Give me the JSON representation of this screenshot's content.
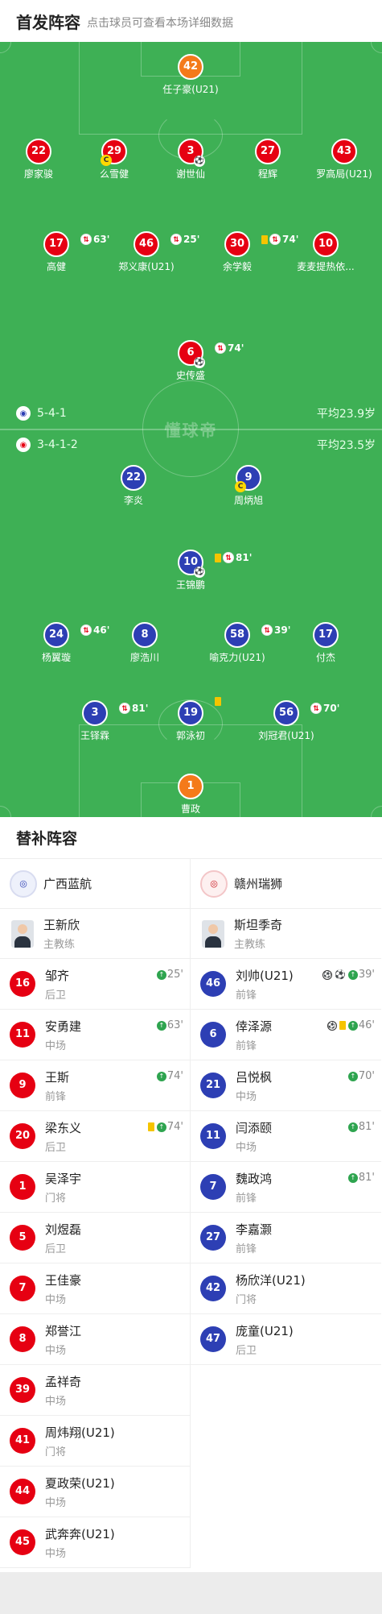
{
  "header": {
    "title": "首发阵容",
    "subtitle": "点击球员可查看本场详细数据"
  },
  "pitch": {
    "watermark": "懂球帝",
    "home_formation": "5-4-1",
    "home_avg_age": "平均23.9岁",
    "away_formation": "3-4-1-2",
    "away_avg_age": "平均23.5岁"
  },
  "home_lineup": [
    {
      "num": "42",
      "name": "任子豪(U21)",
      "gk": true
    },
    {
      "num": "22",
      "name": "廖家骏"
    },
    {
      "num": "29",
      "name": "么雪健",
      "captain": "C"
    },
    {
      "num": "3",
      "name": "谢世仙",
      "goal": true
    },
    {
      "num": "27",
      "name": "程辉"
    },
    {
      "num": "43",
      "name": "罗高局(U21)"
    },
    {
      "num": "17",
      "name": "高健",
      "sub_min": "63'"
    },
    {
      "num": "46",
      "name": "郑义康(U21)",
      "sub_min": "25'"
    },
    {
      "num": "30",
      "name": "余学毅",
      "sub_min": "74'",
      "yellow": true
    },
    {
      "num": "10",
      "name": "麦麦提热依..."
    },
    {
      "num": "6",
      "name": "史传盛",
      "sub_min": "74'",
      "goal": true
    }
  ],
  "away_lineup": [
    {
      "num": "22",
      "name": "李炎"
    },
    {
      "num": "9",
      "name": "周炳旭",
      "captain": "C"
    },
    {
      "num": "10",
      "name": "王锦鹏",
      "sub_min": "81'",
      "yellow": true,
      "assist": true
    },
    {
      "num": "24",
      "name": "杨翼璇",
      "sub_min": "46'"
    },
    {
      "num": "8",
      "name": "廖浩川"
    },
    {
      "num": "58",
      "name": "喻克力(U21)",
      "sub_min": "39'"
    },
    {
      "num": "17",
      "name": "付杰"
    },
    {
      "num": "3",
      "name": "王铎霖",
      "sub_min": "81'"
    },
    {
      "num": "19",
      "name": "郭泳初",
      "yellow": true
    },
    {
      "num": "56",
      "name": "刘冠君(U21)",
      "sub_min": "70'"
    },
    {
      "num": "1",
      "name": "曹政",
      "gk": true
    }
  ],
  "subs": {
    "title": "替补阵容",
    "left": {
      "team": "广西蓝航",
      "coach": {
        "name": "王新欣",
        "role": "主教练"
      },
      "players": [
        {
          "num": "16",
          "name": "邹齐",
          "pos": "后卫",
          "sub_in": "25'"
        },
        {
          "num": "11",
          "name": "安勇建",
          "pos": "中场",
          "sub_in": "63'"
        },
        {
          "num": "9",
          "name": "王斯",
          "pos": "前锋",
          "sub_in": "74'"
        },
        {
          "num": "20",
          "name": "梁东义",
          "pos": "后卫",
          "sub_in": "74'",
          "yellow": true
        },
        {
          "num": "1",
          "name": "吴泽宇",
          "pos": "门将"
        },
        {
          "num": "5",
          "name": "刘煜磊",
          "pos": "后卫"
        },
        {
          "num": "7",
          "name": "王佳豪",
          "pos": "中场"
        },
        {
          "num": "8",
          "name": "郑誉江",
          "pos": "中场"
        },
        {
          "num": "39",
          "name": "孟祥奇",
          "pos": "中场"
        },
        {
          "num": "41",
          "name": "周炜翔(U21)",
          "pos": "门将"
        },
        {
          "num": "44",
          "name": "夏政荣(U21)",
          "pos": "中场"
        },
        {
          "num": "45",
          "name": "武奔奔(U21)",
          "pos": "中场"
        }
      ]
    },
    "right": {
      "team": "赣州瑞狮",
      "coach": {
        "name": "斯坦季奇",
        "role": "主教练"
      },
      "players": [
        {
          "num": "46",
          "name": "刘帅(U21)",
          "pos": "前锋",
          "sub_in": "39'",
          "goal": true,
          "assist": true
        },
        {
          "num": "6",
          "name": "倖泽源",
          "pos": "前锋",
          "sub_in": "46'",
          "goal": true,
          "yellow": true
        },
        {
          "num": "21",
          "name": "吕悦枫",
          "pos": "中场",
          "sub_in": "70'"
        },
        {
          "num": "11",
          "name": "闫添颐",
          "pos": "中场",
          "sub_in": "81'"
        },
        {
          "num": "7",
          "name": "魏政鸿",
          "pos": "前锋",
          "sub_in": "81'"
        },
        {
          "num": "27",
          "name": "李嘉灏",
          "pos": "前锋"
        },
        {
          "num": "42",
          "name": "杨欣洋(U21)",
          "pos": "门将"
        },
        {
          "num": "47",
          "name": "庞童(U21)",
          "pos": "后卫"
        }
      ]
    }
  }
}
